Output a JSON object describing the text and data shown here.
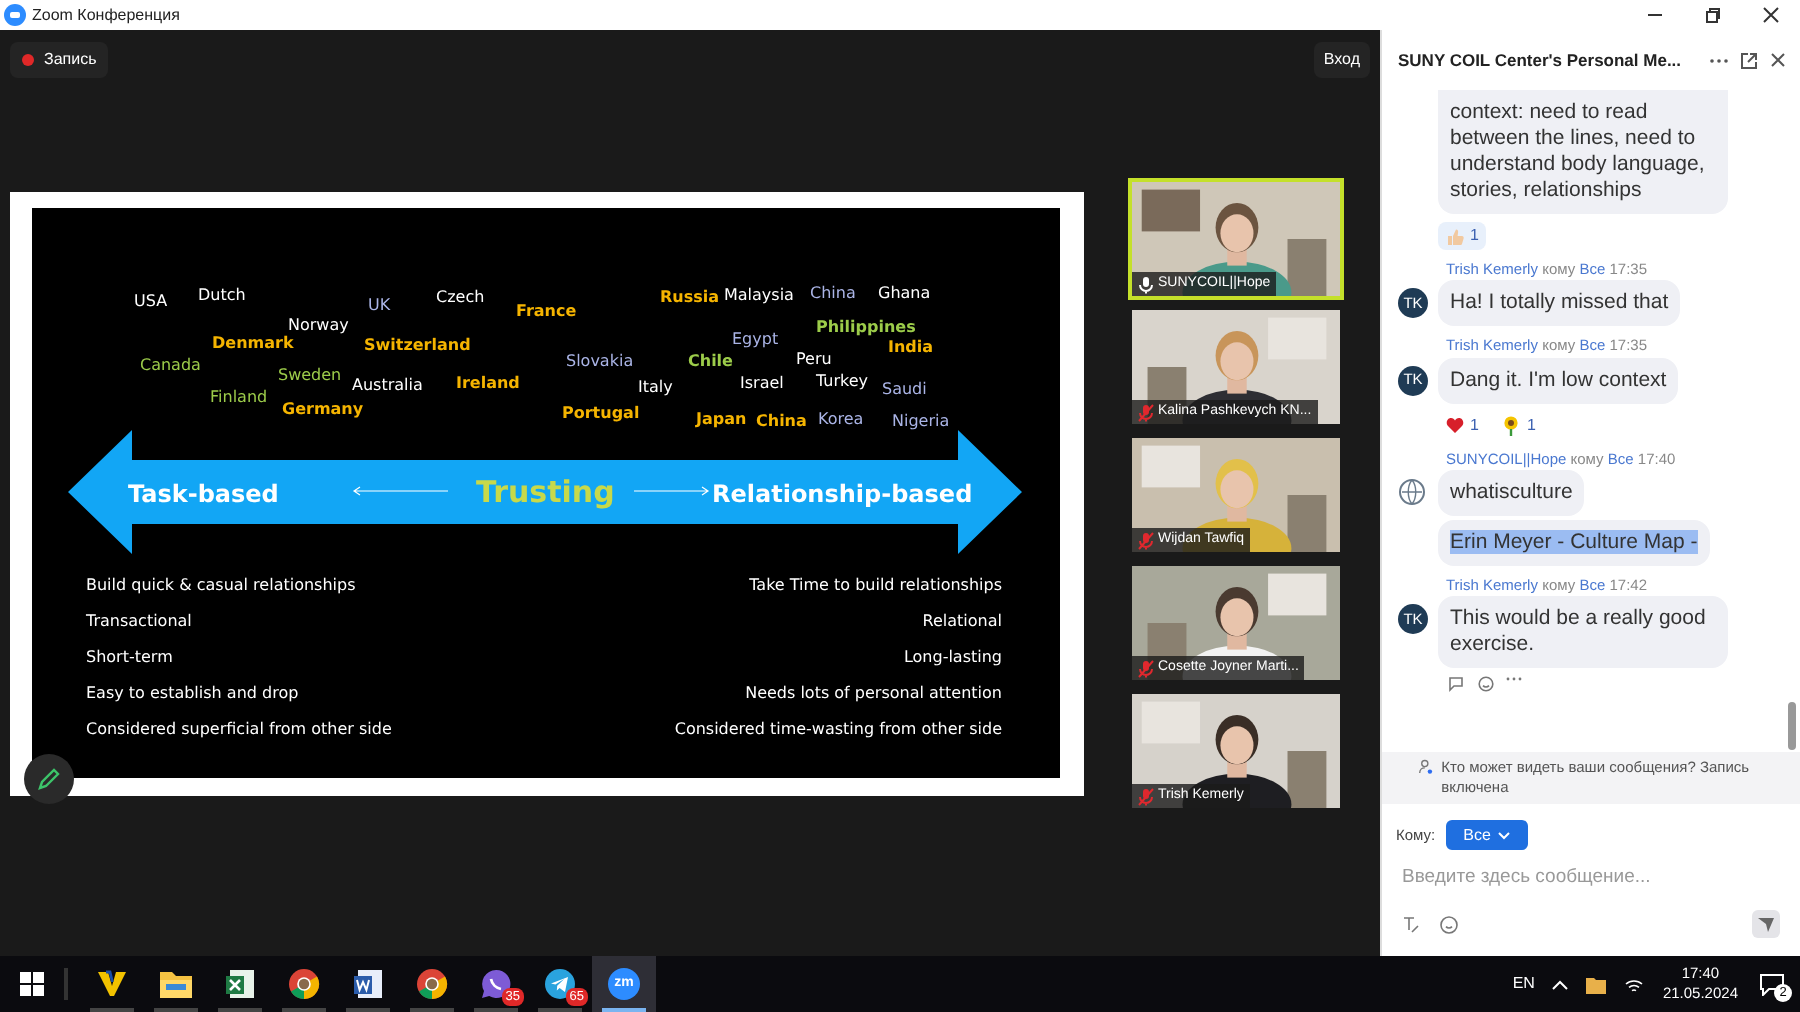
{
  "window": {
    "title": "Zoom Конференция"
  },
  "top_bar": {
    "record_label": "Запись",
    "recording": true,
    "login_label": "Вход"
  },
  "slide": {
    "countries": [
      {
        "name": "USA",
        "color": "#ffffff"
      },
      {
        "name": "Dutch",
        "color": "#ffffff"
      },
      {
        "name": "UK",
        "color": "#aab4e6"
      },
      {
        "name": "Czech",
        "color": "#ffffff"
      },
      {
        "name": "France",
        "color": "#f5b400"
      },
      {
        "name": "Norway",
        "color": "#ffffff"
      },
      {
        "name": "Denmark",
        "color": "#f5b400"
      },
      {
        "name": "Switzerland",
        "color": "#f5b400"
      },
      {
        "name": "Canada",
        "color": "#9ccc4a"
      },
      {
        "name": "Sweden",
        "color": "#9ccc4a"
      },
      {
        "name": "Australia",
        "color": "#ffffff"
      },
      {
        "name": "Ireland",
        "color": "#f5b400"
      },
      {
        "name": "Finland",
        "color": "#9ccc4a"
      },
      {
        "name": "Germany",
        "color": "#f5b400"
      },
      {
        "name": "Slovakia",
        "color": "#aab4e6"
      },
      {
        "name": "Italy",
        "color": "#ffffff"
      },
      {
        "name": "Portugal",
        "color": "#f5b400"
      },
      {
        "name": "Russia",
        "color": "#f5b400"
      },
      {
        "name": "Malaysia",
        "color": "#ffffff"
      },
      {
        "name": "China",
        "color": "#aab4e6"
      },
      {
        "name": "Ghana",
        "color": "#ffffff"
      },
      {
        "name": "Egypt",
        "color": "#aab4e6"
      },
      {
        "name": "Philippines",
        "color": "#9ccc4a"
      },
      {
        "name": "India",
        "color": "#f5b400"
      },
      {
        "name": "Chile",
        "color": "#9ccc4a"
      },
      {
        "name": "Peru",
        "color": "#ffffff"
      },
      {
        "name": "Israel",
        "color": "#ffffff"
      },
      {
        "name": "Turkey",
        "color": "#ffffff"
      },
      {
        "name": "Saudi",
        "color": "#aab4e6"
      },
      {
        "name": "Japan",
        "color": "#f5b400"
      },
      {
        "name": "China",
        "color": "#f5b400"
      },
      {
        "name": "Korea",
        "color": "#aab4e6"
      },
      {
        "name": "Nigeria",
        "color": "#aab4e6"
      }
    ],
    "arrow": {
      "left_label": "Task-based",
      "center_label": "Trusting",
      "right_label": "Relationship-based"
    },
    "left_items": [
      "Build quick & casual relationships",
      "Transactional",
      "Short-term",
      "Easy to establish and drop",
      "Considered superficial from other side"
    ],
    "right_items": [
      "Take Time to build relationships",
      "Relational",
      "Long-lasting",
      "Needs lots of personal attention",
      "Considered time-wasting from other side"
    ]
  },
  "participants": [
    {
      "name": "SUNYCOIL||Hope",
      "muted": false,
      "speaking": true
    },
    {
      "name": "Kalina Pashkevych KN...",
      "muted": true,
      "speaking": false
    },
    {
      "name": "Wijdan Tawfiq",
      "muted": true,
      "speaking": false
    },
    {
      "name": "Cosette Joyner Marti...",
      "muted": true,
      "speaking": false
    },
    {
      "name": "Trish Kemerly",
      "muted": true,
      "speaking": false
    }
  ],
  "chat": {
    "title": "SUNY COIL Center's Personal Me...",
    "messages": [
      {
        "bubbles": [
          {
            "text": "context: need to read between the lines, need to understand body language, stories, relationships",
            "selected": false
          }
        ],
        "reactions": [
          {
            "kind": "thumbs-up",
            "count": "1"
          }
        ]
      },
      {
        "sender": "Trish Kemerly",
        "to": "кому",
        "recipient": "Все",
        "time": "17:35",
        "avatar": {
          "kind": "initials",
          "text": "TK"
        },
        "bubbles": [
          {
            "text": "Ha! I totally missed that",
            "selected": false
          }
        ]
      },
      {
        "sender": "Trish Kemerly",
        "to": "кому",
        "recipient": "Все",
        "time": "17:35",
        "avatar": {
          "kind": "initials",
          "text": "TK"
        },
        "bubbles": [
          {
            "text": "Dang it. I'm low context",
            "selected": false
          }
        ],
        "reactions": [
          {
            "kind": "heart",
            "count": "1"
          },
          {
            "kind": "sunflower",
            "count": "1"
          }
        ]
      },
      {
        "sender": "SUNYCOIL||Hope",
        "to": "кому",
        "recipient": "Все",
        "time": "17:40",
        "avatar": {
          "kind": "logo"
        },
        "bubbles": [
          {
            "text": "whatisculture",
            "selected": false
          },
          {
            "text": "Erin Meyer - Culture Map -",
            "selected": true
          }
        ]
      },
      {
        "sender": "Trish Kemerly",
        "to": "кому",
        "recipient": "Все",
        "time": "17:42",
        "avatar": {
          "kind": "initials",
          "text": "TK"
        },
        "bubbles": [
          {
            "text": "This would be a really good exercise.",
            "selected": false
          }
        ]
      }
    ],
    "notice": "Кто может видеть ваши сообщения? Запись включена",
    "to_label": "Кому:",
    "recipient": "Все",
    "placeholder": "Введите здесь сообщение..."
  },
  "taskbar": {
    "apps": [
      {
        "kind": "v-logo",
        "active": false
      },
      {
        "kind": "folder",
        "active": false
      },
      {
        "kind": "spreadsheet",
        "active": false
      },
      {
        "kind": "browser",
        "active": false
      },
      {
        "kind": "document",
        "active": false
      },
      {
        "kind": "browser",
        "active": false
      },
      {
        "kind": "chat",
        "badge": "35",
        "active": false
      },
      {
        "kind": "plane",
        "badge": "65",
        "active": false
      },
      {
        "kind": "zoom",
        "label": "zm",
        "active": true
      }
    ],
    "language": "EN",
    "time": "17:40",
    "date": "21.05.2024",
    "notifications": "2"
  }
}
